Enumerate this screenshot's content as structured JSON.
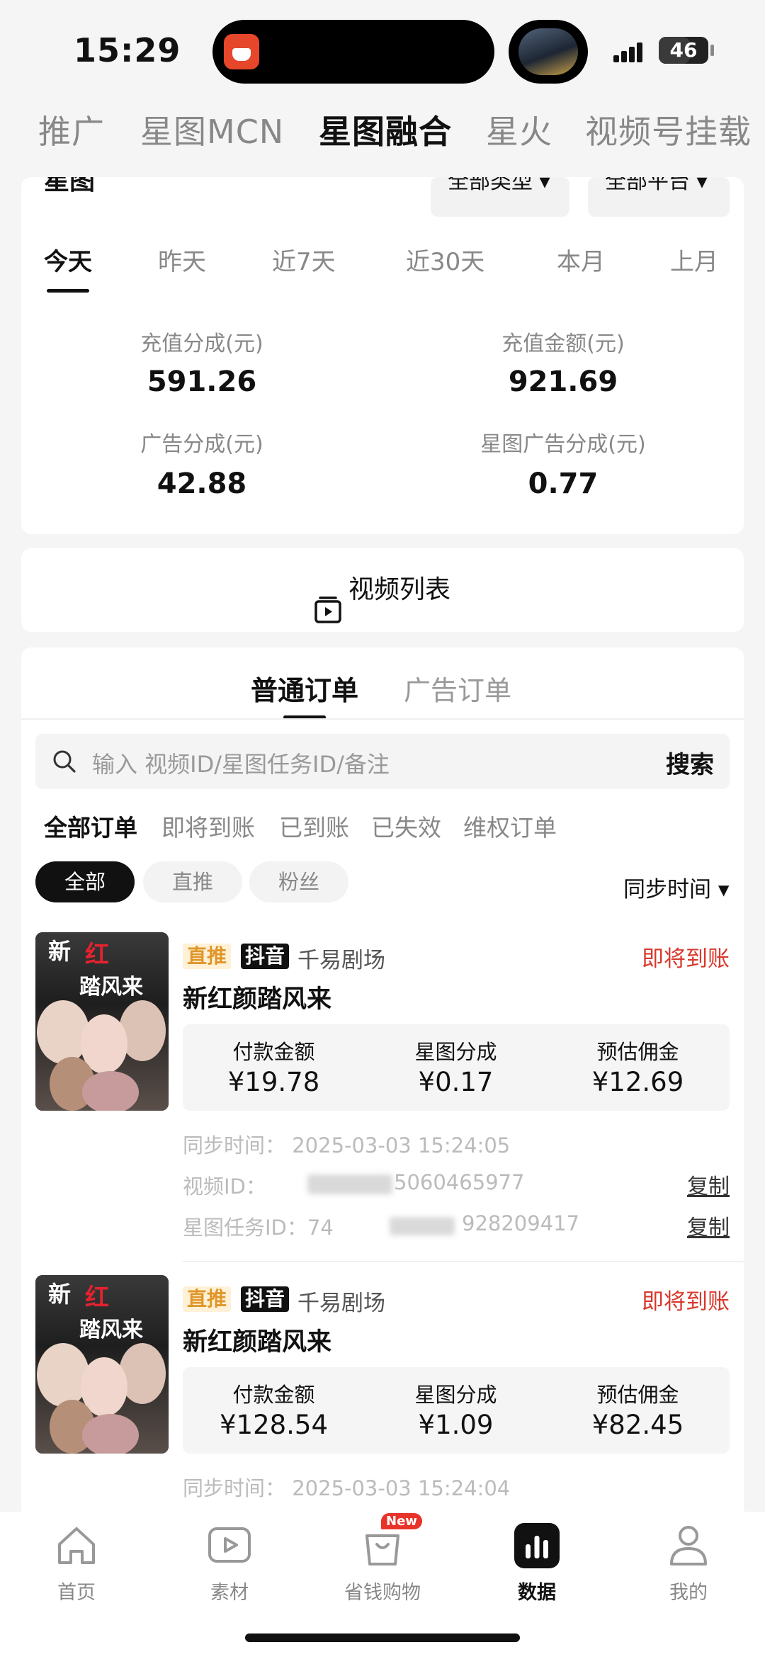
{
  "status_bar": {
    "time": "15:29",
    "battery": "46"
  },
  "top_tabs": [
    "推广",
    "星图MCN",
    "星图融合",
    "星火",
    "视频号挂载"
  ],
  "summary": {
    "label": "星图",
    "type_filter": "全部类型",
    "platform_filter": "全部平台",
    "date_tabs": [
      "今天",
      "昨天",
      "近7天",
      "近30天",
      "本月",
      "上月"
    ],
    "stats": [
      {
        "label": "充值分成(元)",
        "value": "591.26"
      },
      {
        "label": "充值金额(元)",
        "value": "921.69"
      },
      {
        "label": "广告分成(元)",
        "value": "42.88"
      },
      {
        "label": "星图广告分成(元)",
        "value": "0.77"
      }
    ]
  },
  "video_list": {
    "label": "视频列表"
  },
  "orders": {
    "tabs": [
      "普通订单",
      "广告订单"
    ],
    "search": {
      "placeholder": "输入 视频ID/星图任务ID/备注",
      "button": "搜索"
    },
    "filters": [
      "全部订单",
      "即将到账",
      "已到账",
      "已失效",
      "维权订单"
    ],
    "chips": [
      "全部",
      "直推",
      "粉丝"
    ],
    "sort": "同步时间",
    "col_labels": {
      "pay": "付款金额",
      "share": "星图分成",
      "commission": "预估佣金"
    },
    "copy_label": "复制",
    "items": [
      {
        "thumb": {
          "line1": "新",
          "line2": "红",
          "line3": "踏风来"
        },
        "tag_type": "直推",
        "tag_platform": "抖音",
        "theatre": "千易剧场",
        "status": "即将到账",
        "title": "新红颜踏风来",
        "pay": "¥19.78",
        "share": "¥0.17",
        "commission": "¥12.69",
        "sync_time": "同步时间： 2025-03-03 15:24:05",
        "video_id_label": "视频ID：",
        "video_id_suffix": "5060465977",
        "task_id_label": "星图任务ID：",
        "task_id_prefix": "74",
        "task_id_suffix": "928209417"
      },
      {
        "thumb": {
          "line1": "新",
          "line2": "红",
          "line3": "踏风来"
        },
        "tag_type": "直推",
        "tag_platform": "抖音",
        "theatre": "千易剧场",
        "status": "即将到账",
        "title": "新红颜踏风来",
        "pay": "¥128.54",
        "share": "¥1.09",
        "commission": "¥82.45",
        "sync_time": "同步时间： 2025-03-03 15:24:04"
      }
    ]
  },
  "bottom_nav": [
    {
      "label": "首页",
      "icon": "home-icon"
    },
    {
      "label": "素材",
      "icon": "play-icon"
    },
    {
      "label": "省钱购物",
      "icon": "shopping-bag-icon",
      "badge": "New"
    },
    {
      "label": "数据",
      "icon": "bar-chart-icon"
    },
    {
      "label": "我的",
      "icon": "person-icon"
    }
  ],
  "colors": {
    "accent_red": "#d9382c",
    "tag_orange": "#e0962a",
    "dark": "#111111"
  }
}
